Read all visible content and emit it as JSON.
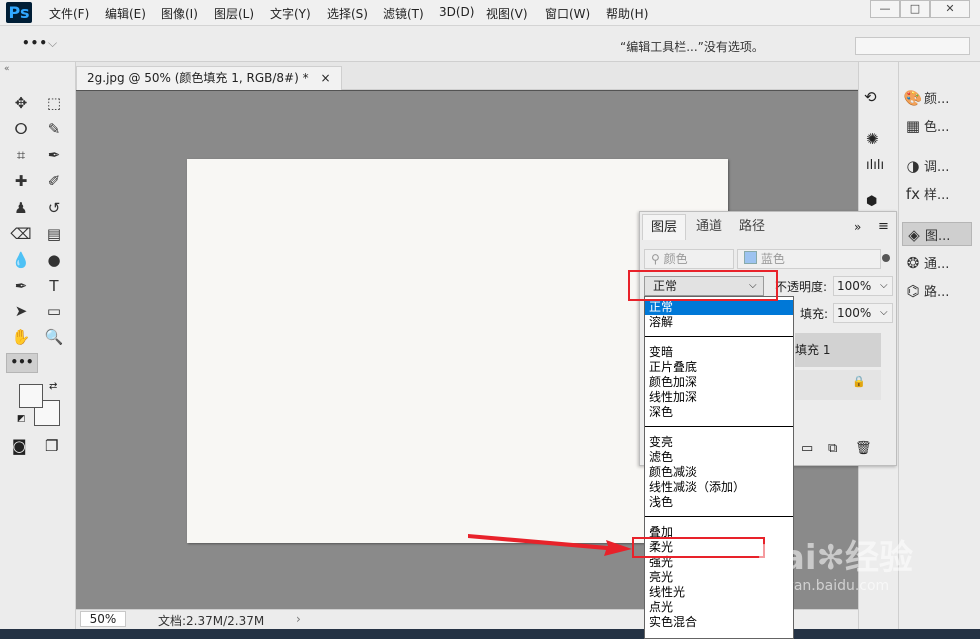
{
  "app": {
    "logo": "Ps"
  },
  "menubar": {
    "items": [
      "文件(F)",
      "编辑(E)",
      "图像(I)",
      "图层(L)",
      "文字(Y)",
      "选择(S)",
      "滤镜(T)",
      "3D(D)",
      "视图(V)",
      "窗口(W)",
      "帮助(H)"
    ]
  },
  "window_controls": [
    "—",
    "□",
    "✕"
  ],
  "options_bar": {
    "more": "•••",
    "message": "“编辑工具栏...”没有选项。"
  },
  "tools": [
    {
      "name": "move-tool",
      "glyph": "✥"
    },
    {
      "name": "marquee-tool",
      "glyph": "⬚"
    },
    {
      "name": "lasso-tool",
      "glyph": "ⵔ"
    },
    {
      "name": "quick-select-tool",
      "glyph": "✎"
    },
    {
      "name": "crop-tool",
      "glyph": "⌗"
    },
    {
      "name": "eyedropper-tool",
      "glyph": "✒"
    },
    {
      "name": "healing-tool",
      "glyph": "✚"
    },
    {
      "name": "brush-tool",
      "glyph": "✐"
    },
    {
      "name": "stamp-tool",
      "glyph": "♟"
    },
    {
      "name": "history-brush-tool",
      "glyph": "↺"
    },
    {
      "name": "eraser-tool",
      "glyph": "⌫"
    },
    {
      "name": "gradient-tool",
      "glyph": "▤"
    },
    {
      "name": "blur-tool",
      "glyph": "💧"
    },
    {
      "name": "dodge-tool",
      "glyph": "●"
    },
    {
      "name": "pen-tool",
      "glyph": "✒"
    },
    {
      "name": "type-tool",
      "glyph": "T"
    },
    {
      "name": "path-select-tool",
      "glyph": "➤"
    },
    {
      "name": "rectangle-tool",
      "glyph": "▭"
    },
    {
      "name": "hand-tool",
      "glyph": "✋"
    },
    {
      "name": "zoom-tool",
      "glyph": "🔍"
    }
  ],
  "toolbox": {
    "more": "•••"
  },
  "document": {
    "tab_title": "2g.jpg @ 50% (颜色填充 1, RGB/8#) *",
    "close": "×",
    "zoom": "50%",
    "doc_size": "文档:2.37M/2.37M"
  },
  "panels_strip": [
    {
      "label": "颜...",
      "icon": "palette-icon",
      "glyph": "🎨"
    },
    {
      "label": "色...",
      "icon": "swatches-icon",
      "glyph": "▦"
    },
    {
      "label": "调...",
      "icon": "adjustments-icon",
      "glyph": "◑"
    },
    {
      "label": "样...",
      "icon": "styles-icon",
      "glyph": "fx"
    },
    {
      "label": "图...",
      "icon": "layers-icon",
      "glyph": "◈"
    },
    {
      "label": "通...",
      "icon": "channels-icon",
      "glyph": "❂"
    },
    {
      "label": "路...",
      "icon": "paths-icon",
      "glyph": "⌬"
    }
  ],
  "layers_panel": {
    "tabs": [
      "图层",
      "通道",
      "路径"
    ],
    "filter_kind": "颜色",
    "filter_color": "蓝色",
    "blend_mode": "正常",
    "opacity_label": "不透明度:",
    "opacity_value": "100%",
    "fill_label": "填充:",
    "fill_value": "100%",
    "layer_name": "填充 1",
    "lock": "🔒"
  },
  "blend_options": [
    {
      "label": "正常",
      "selected": true
    },
    {
      "label": "溶解"
    },
    {
      "sep": true
    },
    {
      "label": "变暗"
    },
    {
      "label": "正片叠底"
    },
    {
      "label": "颜色加深"
    },
    {
      "label": "线性加深"
    },
    {
      "label": "深色"
    },
    {
      "sep": true
    },
    {
      "label": "变亮"
    },
    {
      "label": "滤色"
    },
    {
      "label": "颜色减淡"
    },
    {
      "label": "线性减淡（添加）"
    },
    {
      "label": "浅色"
    },
    {
      "sep": true
    },
    {
      "label": "叠加"
    },
    {
      "label": "柔光"
    },
    {
      "label": "强光"
    },
    {
      "label": "亮光"
    },
    {
      "label": "线性光"
    },
    {
      "label": "点光"
    },
    {
      "label": "实色混合"
    }
  ],
  "watermark": {
    "brand": "Bai",
    "brand2": "经验",
    "url": "jingyan.baidu.com"
  },
  "colors": {
    "highlight": "#e8222a",
    "selection": "#0078d7",
    "canvas_bg": "#8a8a8a"
  }
}
